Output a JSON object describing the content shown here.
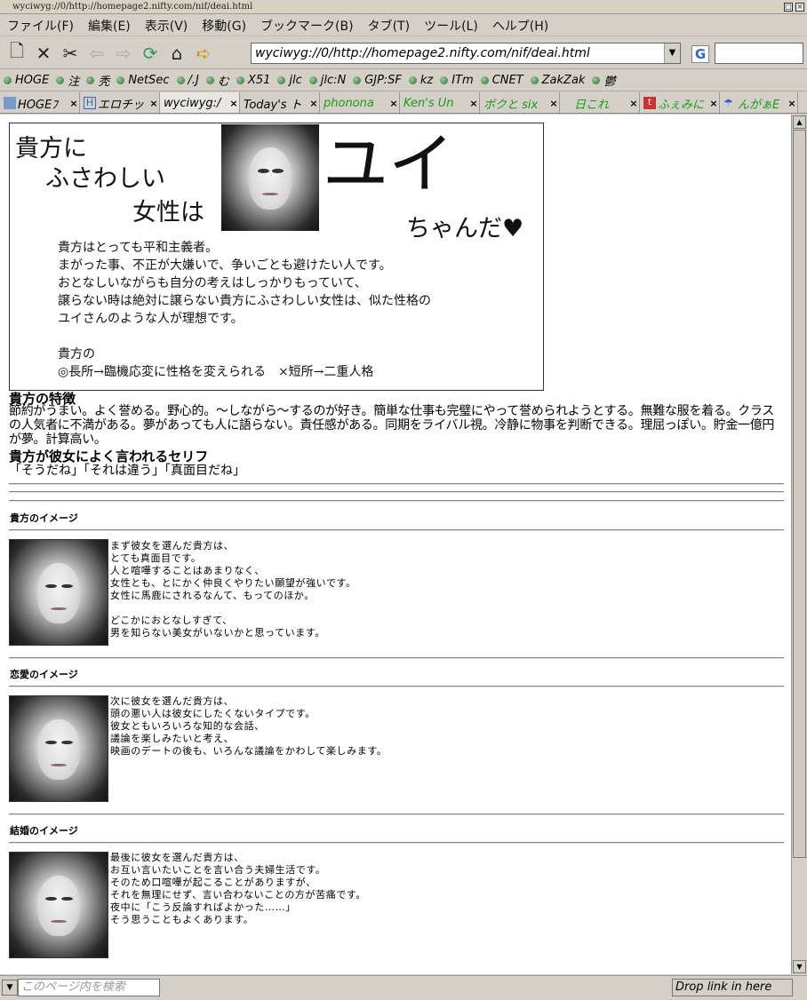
{
  "window": {
    "title": "wyciwyg://0/http://homepage2.nifty.com/nif/deai.html"
  },
  "menu": [
    "ファイル(F)",
    "編集(E)",
    "表示(V)",
    "移動(G)",
    "ブックマーク(B)",
    "タブ(T)",
    "ツール(L)",
    "ヘルプ(H)"
  ],
  "nav": {
    "url": "wyciwyg://0/http://homepage2.nifty.com/nif/deai.html",
    "search_value": ""
  },
  "bookmarks": [
    "HOGE",
    "注",
    "秃",
    "NetSec",
    "/.J",
    "む",
    "X51",
    "jlc",
    "jlc:N",
    "GJP:SF",
    "kz",
    "ITm",
    "CNET",
    "ZakZak",
    "鬱"
  ],
  "tabs": [
    {
      "label": "HOGEﾌ",
      "close": "×",
      "green": false
    },
    {
      "label": "エロチッ",
      "close": "×",
      "green": false
    },
    {
      "label": "wyciwyg:/",
      "close": "×",
      "green": false
    },
    {
      "label": "Today's ト",
      "close": "×",
      "green": false
    },
    {
      "label": "phonona",
      "close": "×",
      "green": true
    },
    {
      "label": "Ken's Un",
      "close": "×",
      "green": true
    },
    {
      "label": "ボクと six",
      "close": "×",
      "green": true
    },
    {
      "label": "日これ",
      "close": "×",
      "green": true
    },
    {
      "label": "ふぇみに",
      "close": "×",
      "green": true
    },
    {
      "label": "んがぁE",
      "close": "×",
      "green": true
    }
  ],
  "card": {
    "line1": "貴方に",
    "line2": "ふさわしい",
    "line3": "女性は",
    "name": "ユイ",
    "chanda": "ちゃんだ♥",
    "text": "貴方はとっても平和主義者。\nまがった事、不正が大嫌いで、争いごとも避けたい人です。\nおとなしいながらも自分の考えはしっかりもっていて、\n譲らない時は絶対に譲らない貴方にふさわしい女性は、似た性格の\nユイさんのような人が理想です。\n\n貴方の\n◎長所→臨機応変に性格を変えられる　×短所→二重人格"
  },
  "traits": {
    "title": "貴方の特徴",
    "body": "節約がうまい。よく誉める。野心的。～しながら～するのが好き。簡単な仕事も完璧にやって誉められようとする。無難な服を着る。クラスの人気者に不満がある。夢があっても人に語らない。責任感がある。同期をライバル視。冷静に物事を判断できる。理屈っぽい。貯金一億円が夢。計算高い。"
  },
  "serif": {
    "title": "貴方が彼女によく言われるセリフ",
    "body": "「そうだね」「それは違う」「真面目だね」"
  },
  "sections": [
    {
      "title": "貴方のイメージ",
      "text": "まず彼女を選んだ貴方は、\nとても真面目です。\n人と喧嘩することはあまりなく、\n女性とも、とにかく仲良くやりたい願望が強いです。\n女性に馬鹿にされるなんて、もってのほか。\n\nどこかにおとなしすぎて、\n男を知らない美女がいないかと思っています。"
    },
    {
      "title": "恋愛のイメージ",
      "text": "次に彼女を選んだ貴方は、\n頭の悪い人は彼女にしたくないタイプです。\n彼女ともいろいろな知的な会話、\n議論を楽しみたいと考え、\n映画のデートの後も、いろんな議論をかわして楽しみます。"
    },
    {
      "title": "結婚のイメージ",
      "text": "最後に彼女を選んだ貴方は、\nお互い言いたいことを言い合う夫婦生活です。\nそのため口喧嘩が起こることがありますが、\nそれを無理にせず、言い合わないことの方が苦痛です。\n夜中に「こう反論すればよかった……」\nそう思うこともよくあります。"
    }
  ],
  "status": {
    "find_placeholder": "このページ内を検索",
    "drop": "Drop link in here"
  }
}
